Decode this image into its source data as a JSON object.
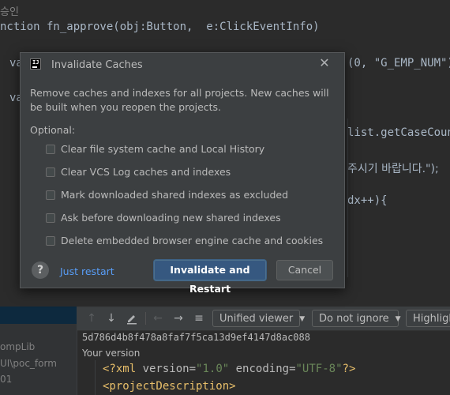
{
  "editor": {
    "lines": [
      {
        "id": "comment",
        "text": "승인"
      },
      {
        "id": "fn",
        "text": "nction fn_approve(obj:Button,  e:ClickEventInfo)"
      },
      {
        "id": "va1",
        "text": "va"
      },
      {
        "id": "va1-right",
        "text": "(0, \"G_EMP_NUM\"))"
      },
      {
        "id": "va2",
        "text": "va"
      },
      {
        "id": "list",
        "text": "list.getCaseCount"
      },
      {
        "id": "korean",
        "text": "주시기 바랍니다.\");"
      },
      {
        "id": "loop",
        "text": "dx++){"
      }
    ]
  },
  "dialog": {
    "title": "Invalidate Caches",
    "description": "Remove caches and indexes for all projects. New caches will be built when you reopen the projects.",
    "optional_label": "Optional:",
    "options": [
      {
        "label": "Clear file system cache and Local History",
        "checked": false
      },
      {
        "label": "Clear VCS Log caches and indexes",
        "checked": false
      },
      {
        "label": "Mark downloaded shared indexes as excluded",
        "checked": false
      },
      {
        "label": "Ask before downloading new shared indexes",
        "checked": false
      },
      {
        "label": "Delete embedded browser engine cache and cookies",
        "checked": false
      }
    ],
    "help_label": "?",
    "just_restart_label": "Just restart",
    "primary_button_label": "Invalidate and Restart",
    "cancel_button_label": "Cancel"
  },
  "left_panel": {
    "lines": [
      "ompLib",
      "UI\\poc_form",
      "01"
    ]
  },
  "diff_toolbar": {
    "viewer_label": "Unified viewer",
    "ignore_label": "Do not ignore",
    "highlight_label": "Highlight"
  },
  "diff": {
    "hash": "5d786d4b8f478a8faf7f5ca13d9ef4147d8ac088",
    "your_version": "Your version",
    "xml_decl": {
      "open": "<?xml ",
      "attr1": "version",
      "val1": "\"1.0\"",
      "attr2": "encoding",
      "val2": "\"UTF-8\"",
      "close": "?>"
    },
    "xml_tag": "<projectDescription>"
  },
  "colors": {
    "editor_bg": "#2b2b2b",
    "dialog_bg": "#3c3f41",
    "accent_button": "#365880",
    "link": "#589df6"
  }
}
